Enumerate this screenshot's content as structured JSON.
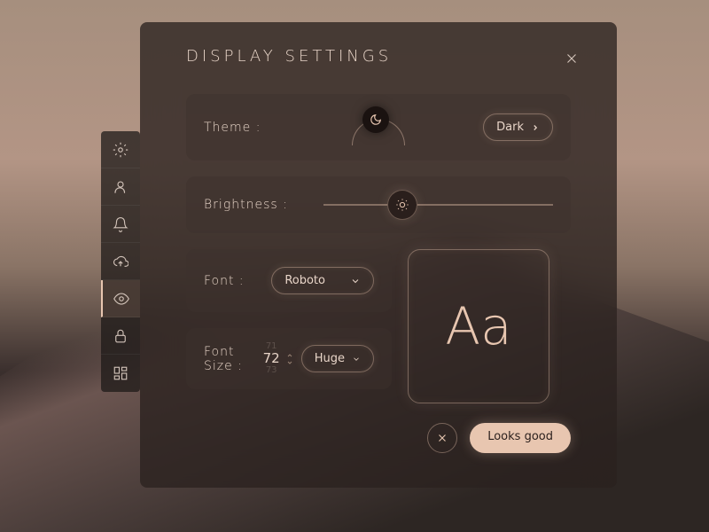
{
  "title": "DISPLAY SETTINGS",
  "labels": {
    "theme": "Theme :",
    "brightness": "Brightness :",
    "font": "Font :",
    "fontSize": "Font Size :"
  },
  "theme": {
    "value": "Dark"
  },
  "font": {
    "selected": "Roboto"
  },
  "fontSize": {
    "prev": "71",
    "current": "72",
    "next": "73",
    "label": "Huge"
  },
  "preview": "Aa",
  "actions": {
    "confirm": "Looks good"
  }
}
